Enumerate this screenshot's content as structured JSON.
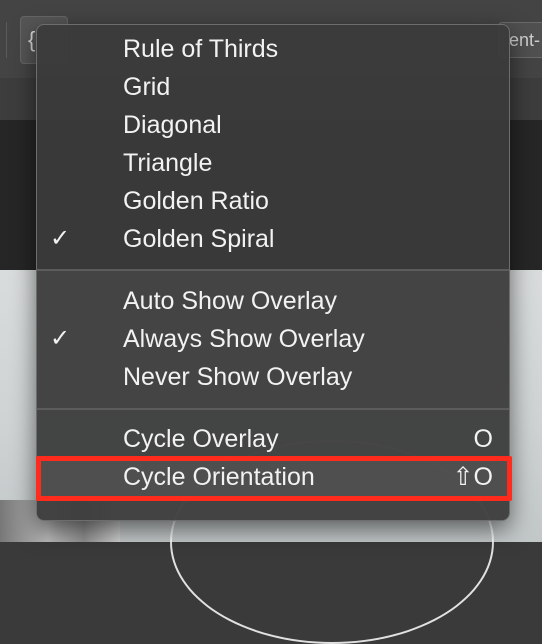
{
  "toolbar": {
    "overlay_button_glyph": "{",
    "right_field_text": "ent-"
  },
  "menu": {
    "group1": [
      {
        "label": "Rule of Thirds",
        "checked": false
      },
      {
        "label": "Grid",
        "checked": false
      },
      {
        "label": "Diagonal",
        "checked": false
      },
      {
        "label": "Triangle",
        "checked": false
      },
      {
        "label": "Golden Ratio",
        "checked": false
      },
      {
        "label": "Golden Spiral",
        "checked": true
      }
    ],
    "group2": [
      {
        "label": "Auto Show Overlay",
        "checked": false
      },
      {
        "label": "Always Show Overlay",
        "checked": true
      },
      {
        "label": "Never Show Overlay",
        "checked": false
      }
    ],
    "group3": [
      {
        "label": "Cycle Overlay",
        "shortcut": "O"
      },
      {
        "label": "Cycle Orientation",
        "shortcut": "⇧O"
      }
    ],
    "check_glyph": "✓",
    "highlight_color": "#ff2b1c"
  }
}
